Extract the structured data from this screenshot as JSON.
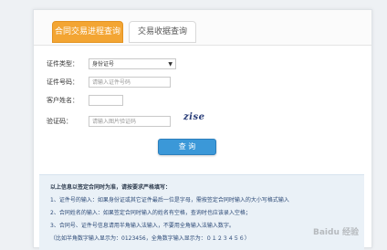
{
  "tabs": [
    {
      "label": "合同交易进程查询",
      "active": true
    },
    {
      "label": "交易收据查询",
      "active": false
    }
  ],
  "form": {
    "id_type_label": "证件类型：",
    "id_type_value": "身份证号",
    "id_no_label": "证件号码：",
    "id_no_placeholder": "请输入证件号码",
    "name_label": "客户姓名：",
    "name_value": "",
    "captcha_label": "验证码：",
    "captcha_placeholder": "请输入图片验证码",
    "captcha_image_text": "zise",
    "submit_label": "查 询"
  },
  "notice": {
    "title": "以上信息以签定合同时为准，请按要求严格填写：",
    "rules": [
      "1、证件号的输入：如果身份证或其它证件最后一位是字母，需按签定合同时输入的大小写格式输入",
      "2、合同姓名的输入：如果签定合同时输入的姓名有空格，查询时也应该录入空格；",
      "3、合同号、证件号信息请用半角输入法输入，不要用全角输入法输入数字。",
      "（比如半角数字输入显示为：0123456，全角数字输入显示为：０１２３４５６）"
    ]
  },
  "watermark": "Baidu 经验",
  "colors": {
    "tab_active": "#f3a533",
    "button": "#3b98d8",
    "notice_bg": "#eaf1f7"
  }
}
